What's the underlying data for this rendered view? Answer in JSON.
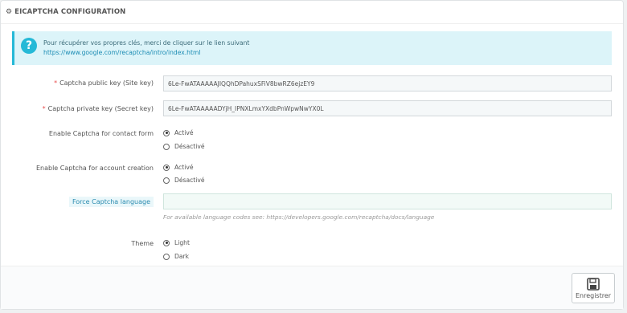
{
  "panel": {
    "title": "EICAPTCHA CONFIGURATION",
    "title_icon": "cogs-icon"
  },
  "alert": {
    "text": "Pour récupérer vos propres clés, merci de cliquer sur le lien suivant",
    "link": "https://www.google.com/recaptcha/intro/index.html"
  },
  "fields": {
    "public_key": {
      "label": "Captcha public key (Site key)",
      "required": "*",
      "value": "6Le-FwATAAAAAJIQQhDPahuxSFiV8bwRZ6ejzEY9"
    },
    "private_key": {
      "label": "Captcha private key (Secret key)",
      "required": "*",
      "value": "6Le-FwATAAAAADYjH_IPNXLmxYXdbPnWpwNwYX0L"
    },
    "contact_form": {
      "label": "Enable Captcha for contact form",
      "options": [
        "Activé",
        "Désactivé"
      ],
      "selected": "Activé"
    },
    "account_creation": {
      "label": "Enable Captcha for account creation",
      "options": [
        "Activé",
        "Désactivé"
      ],
      "selected": "Activé"
    },
    "language": {
      "label": "Force Captcha language",
      "value": "",
      "help": "For available language codes see: https://developers.google.com/recaptcha/docs/language"
    },
    "theme": {
      "label": "Theme",
      "options": [
        "Light",
        "Dark"
      ],
      "selected": "Light"
    }
  },
  "footer": {
    "save_label": "Enregistrer",
    "save_icon": "save-icon"
  }
}
